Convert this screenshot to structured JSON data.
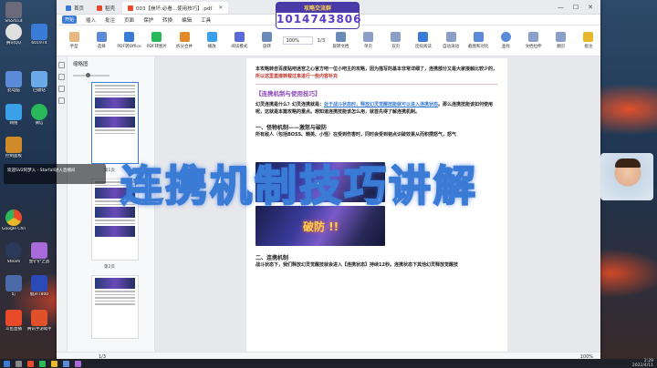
{
  "desktop": {
    "icons": [
      {
        "label": "Shortcut",
        "color": "#6a6a7a"
      },
      {
        "label": "腾讯QQ",
        "color": "#e0e0e0"
      },
      {
        "label": "601974",
        "color": "#3a7bd5"
      },
      {
        "label": "此电脑",
        "color": "#5a8ad8"
      },
      {
        "label": "回收站",
        "color": "#6aaae8"
      },
      {
        "label": "网络",
        "color": "#3aa0e8"
      },
      {
        "label": "微信",
        "color": "#2ab85a"
      },
      {
        "label": "控制面板",
        "color": "#d08a2a"
      },
      {
        "label": "Google Chrome",
        "color": "#e8b82a"
      },
      {
        "label": "Steam",
        "color": "#2a3a5a"
      },
      {
        "label": "金铲铲之战",
        "color": "#a86ad8"
      },
      {
        "label": "幻",
        "color": "#4a6aa8"
      },
      {
        "label": "魅声T800",
        "color": "#2a4ab8"
      },
      {
        "label": "斗鱼直播",
        "color": "#e84a2a"
      },
      {
        "label": "腾讯手游助手",
        "color": "#e0502a"
      }
    ]
  },
  "overlay": {
    "message": "欢迎SV2阿梦入 - Starfall进入直播间",
    "banner": "连携机制技巧讲解",
    "promo_title": "攻略交流群",
    "promo_number": "1014743806"
  },
  "window": {
    "tabs": [
      {
        "label": "首页",
        "color": "#3a7bd5",
        "active": false
      },
      {
        "label": "稻壳",
        "color": "#e84a2a",
        "active": false
      },
      {
        "label": "003【崩坏:必看...使用技巧】.pdf",
        "color": "#e84a2a",
        "active": true
      }
    ],
    "controls": {
      "minimize": "—",
      "maximize": "☐",
      "close": "✕"
    },
    "menu_badge": "开始",
    "menus": [
      "插入",
      "批注",
      "页面",
      "保护",
      "转换",
      "编辑",
      "工具"
    ],
    "toolbar": {
      "tools": [
        "手型",
        "选择",
        "PDF转Office",
        "PDF转图片",
        "拆分合并",
        "播放",
        "阅读模式",
        "旋转"
      ],
      "zoom": "100%",
      "page": "1/3",
      "right_tools": [
        "旋转文档",
        "单页",
        "双页",
        "连续阅读",
        "自动滚动",
        "截图和对比",
        "查找",
        "文档拉伸",
        "翻页",
        "批注"
      ]
    },
    "thumbnails": {
      "title": "缩略图",
      "labels": [
        "第1页",
        "第2页",
        "第3页"
      ]
    },
    "document": {
      "intro_before": "本攻略转自百度贴吧迷宫之心官方吧一位小吧主的攻略，因为描写的基本非常详细了，连携部分又是大家接触比较少的，",
      "intro_highlight": "所以这里直接转载过来进行一些内容补充",
      "section_title": "【连携机制与使用技巧】",
      "para_before": "幻灵连携是什么？幻灵连携就是：",
      "para_blue": "处于战斗状态时，释放幻灵觉醒技能就可以进入连携状态",
      "para_after": "。那么连携技能该如何使用呢，这就是本篇攻略的重点。想知道连携技能该怎么用，就首先得了解连携机制。",
      "h_monster": "一、怪物机制——激怒与破防",
      "monster_text": "所有敌人（包括BOSS、精英、小怪）在受到伤害时，同时会受到韧点识破效果从而积攒怒气，怒气",
      "game_overlay_text": "破防 !!",
      "h_combo": "二、连携机制",
      "combo_text": "战斗状态下，我们释放幻灵觉醒技就会进入【连携状态】持续12秒。连携状态下其他幻灵释放觉醒技"
    },
    "status": {
      "page": "1/3",
      "zoom": "100%"
    }
  },
  "taskbar": {
    "time": "2:29",
    "date": "2022/4/11"
  }
}
